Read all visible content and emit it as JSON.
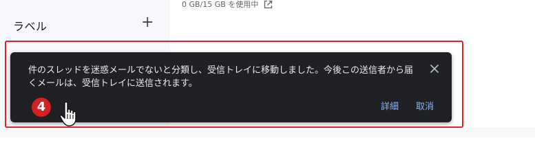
{
  "sidebar": {
    "labels_title": "ラベル",
    "add_label_symbol": "+"
  },
  "storage": {
    "text": "0 GB/15 GB を使用中",
    "icon": "open-in-new-icon"
  },
  "toast": {
    "message": "件のスレッドを迷惑メールでないと分類し、受信トレイに移動しました。今後この送信者から届くメールは、受信トレイに送信されます。",
    "close_icon": "close-icon",
    "details_label": "詳細",
    "cancel_label": "取消"
  },
  "annotation": {
    "step_number": "4",
    "cursor_icon": "hand-pointer-icon",
    "highlight_color": "#e0232a"
  },
  "colors": {
    "toast_bg": "#202124",
    "toast_text": "#e8eaed",
    "action_link": "#8ab4f8",
    "badge_bg": "#d32222"
  }
}
